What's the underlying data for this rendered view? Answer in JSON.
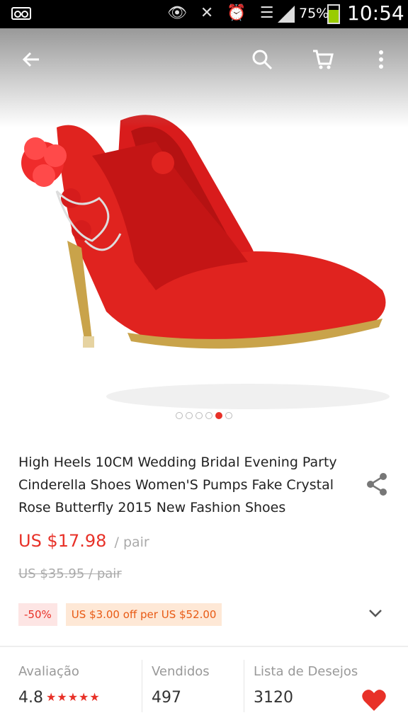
{
  "status_bar": {
    "battery": "75%",
    "battery_level": 0.75,
    "time": "10:54"
  },
  "toolbar": {
    "back_icon": "arrow-left-icon",
    "search_icon": "search-icon",
    "cart_icon": "cart-icon",
    "more_icon": "more-vertical-icon"
  },
  "gallery": {
    "total_images": 6,
    "active_index": 4
  },
  "product": {
    "title_line1": "High Heels 10CM Wedding Bridal Evening Party",
    "title_line2": "Cinderella Shoes Women'S Pumps Fake Crystal",
    "title_line3": "Rose Butterfly 2015 New Fashion Shoes",
    "price": "US $17.98",
    "price_unit": "/ pair",
    "original_price": "US $35.95 / pair",
    "discount_badge": "-50%",
    "coupon_badge": "US $3.00 off per US $52.00"
  },
  "stats": {
    "rating_label": "Avaliação",
    "rating_value": "4.8",
    "rating_stars": "★★★★★",
    "sold_label": "Vendidos",
    "sold_value": "497",
    "wishlist_label": "Lista de Desejos",
    "wishlist_value": "3120"
  },
  "colors": {
    "accent": "#e83128",
    "coupon_text": "#e85a14"
  }
}
